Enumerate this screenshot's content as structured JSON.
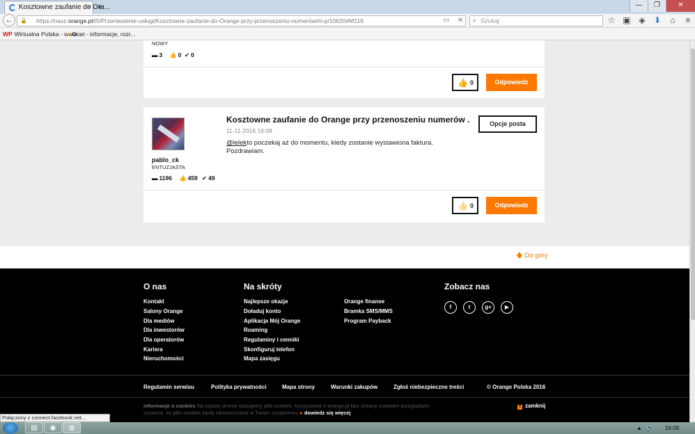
{
  "browser": {
    "tab_title": "Kosztowne zaufanie do Ora...",
    "tab_close": "×",
    "new_tab": "+",
    "window_controls": [
      "—",
      "❐",
      "✕"
    ],
    "back_icon": "←",
    "url_prefix": "https://nasz.",
    "url_domain": "orange.pl",
    "url_rest": "/t5/Przeniesienie-usługi/Kosztowne-zaufanie-do-Orange-przy-przenoszeniu-numerów/m-p/10620#M116",
    "url_reader_icon": "▭",
    "url_clear_icon": "✕",
    "search_placeholder": "Szukaj",
    "toolbar_icons": [
      "☆",
      "▣",
      "◈",
      "⬇",
      "⌂",
      "≡"
    ],
    "bookmarks": [
      {
        "icon": "WP",
        "label": "Wirtualna Polska - www...."
      },
      {
        "icon": "●",
        "label": "Onet - informacje, rozr..."
      }
    ]
  },
  "posts": {
    "first": {
      "rank": "NOWY",
      "replies": "3",
      "likes": "0",
      "solutions": "0",
      "kudos": "0",
      "reply_label": "Odpowiedz"
    },
    "second": {
      "title": "Kosztowne zaufanie do Orange przy przenoszeniu numerów .",
      "date": "11-11-2016",
      "time": "16:08",
      "mention": "@lelek",
      "body_line1": "to poczekaj aż do momentu, kiedy zostanie wystawiona faktura.",
      "body_line2": "Pozdrawiam.",
      "author": "pablo_ck",
      "rank": "ENTUZJASTA",
      "replies": "1196",
      "likes": "459",
      "solutions": "49",
      "options_label": "Opcje posta",
      "kudos": "0",
      "reply_label": "Odpowiedz"
    }
  },
  "back_to_top": "Do góry",
  "footer": {
    "col1_title": "O nas",
    "col1_links": [
      "Kontakt",
      "Salony Orange",
      "Dla mediów",
      "Dla inwestorów",
      "Dla operatorów",
      "Kariera",
      "Nieruchomości"
    ],
    "col2_title": "Na skróty",
    "col2_links": [
      "Najlepsze okazje",
      "Doładuj konto",
      "Aplikacja Mój Orange",
      "Roaming",
      "Regulaminy i cenniki",
      "Skonfiguruj telefon",
      "Mapa zasięgu"
    ],
    "col3_links": [
      "Orange finanse",
      "Bramka SMS/MMS",
      "Program Payback"
    ],
    "col4_title": "Zobacz nas",
    "social": [
      "f",
      "t",
      "g+",
      "▶"
    ],
    "legal_links": [
      "Regulamin serwisu",
      "Polityka prywatności",
      "Mapa strony",
      "Warunki zakupów",
      "Zgłoś niebezpieczne treści"
    ],
    "copyright": "© Orange Polska 2016",
    "cookie_title": "informacje o cookies",
    "cookie_text1": "Na naszej stronie stosujemy pliki cookies. Korzystanie z orange.pl bez zmiany ustawień przeglądarki",
    "cookie_text2": "oznacza, że pliki cookies będą zamieszczane w Twoim urządzeniu.",
    "cookie_more": "dowiedz się więcej",
    "cookie_close": "zamknij"
  },
  "status_bar": "Połączony z connect.facebook.net...",
  "taskbar": {
    "clock": "16:09"
  },
  "colors": {
    "orange": "#ff7900",
    "footer_bg": "#000000",
    "page_bg": "#ececec"
  }
}
